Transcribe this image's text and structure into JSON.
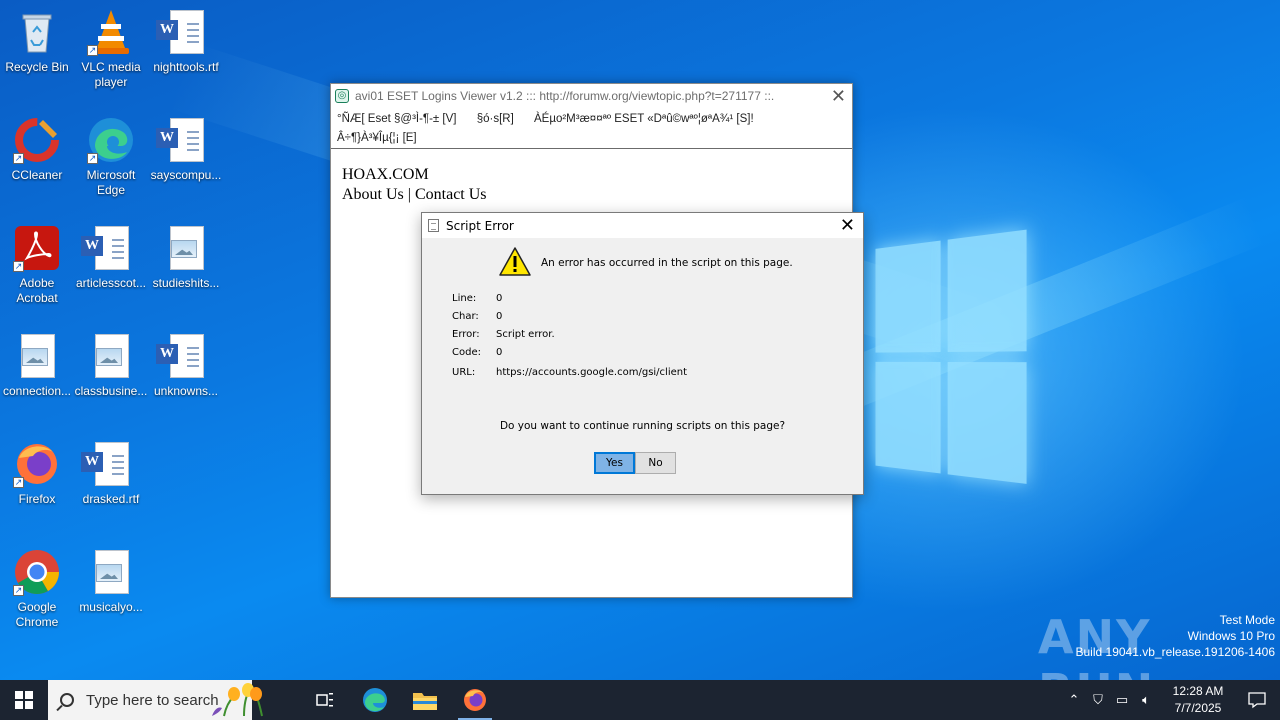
{
  "desktop": {
    "icons": [
      {
        "label": "Recycle Bin"
      },
      {
        "label": "VLC media player"
      },
      {
        "label": "nighttools.rtf"
      },
      {
        "label": "CCleaner"
      },
      {
        "label": "Microsoft Edge"
      },
      {
        "label": "sayscompu..."
      },
      {
        "label": "Adobe Acrobat"
      },
      {
        "label": "articlesscot..."
      },
      {
        "label": "studieshits..."
      },
      {
        "label": "connection..."
      },
      {
        "label": "classbusine..."
      },
      {
        "label": "unknowns..."
      },
      {
        "label": "Firefox"
      },
      {
        "label": "drasked.rtf"
      },
      {
        "label": "Google Chrome"
      },
      {
        "label": "musicalyo..."
      }
    ]
  },
  "main_window": {
    "title": "avi01 ESET Logins Viewer v1.2 ::: http://forumw.org/viewtopic.php?t=271177 ::.",
    "close": "✕",
    "menu": [
      "°ÑÆ[ Eset §@³Ì-¶-± [V]",
      "§ó·s[R]",
      "ÀÉµo²M³æ¤¤ªº ESET «Dªû©wªº¦øªA¾¹ [S]!",
      "Â÷¶}À³¥Îµ{¦¡ [E]"
    ],
    "content": {
      "site": "HOAX.COM",
      "about": "About Us",
      "separator": "|",
      "contact": "Contact Us"
    }
  },
  "dialog": {
    "title": "Script Error",
    "close": "✕",
    "message": "An error has occurred in the script on this page.",
    "fields": [
      {
        "label": "Line:",
        "value": "0"
      },
      {
        "label": "Char:",
        "value": "0"
      },
      {
        "label": "Error:",
        "value": "Script error."
      },
      {
        "label": "Code:",
        "value": "0"
      },
      {
        "label": "URL:",
        "value": "https://accounts.google.com/gsi/client"
      }
    ],
    "question": "Do you want to continue running scripts on this page?",
    "yes": "Yes",
    "no": "No"
  },
  "watermark": {
    "brand": "ANY RUN",
    "line1": "Test Mode",
    "line2": "Windows 10 Pro",
    "line3": "Build 19041.vb_release.191206-1406"
  },
  "taskbar": {
    "search_placeholder": "Type here to search",
    "time": "12:28 AM",
    "date": "7/7/2025"
  },
  "colors": {
    "desktop_blue": "#0b78e0",
    "taskbar": "#1c2431",
    "dialog_bg": "#f0f0f0",
    "focus_blue": "#0078d7"
  }
}
